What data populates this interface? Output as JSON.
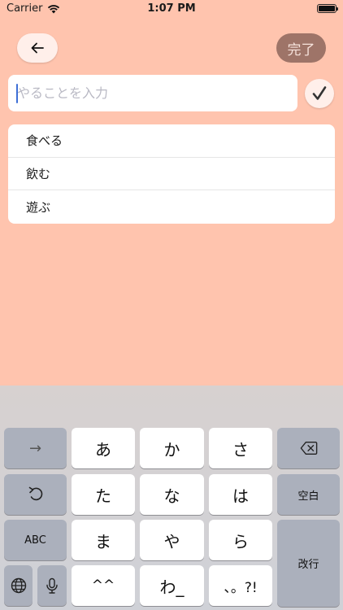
{
  "status_bar": {
    "carrier": "Carrier",
    "time": "1:07 PM"
  },
  "header": {
    "back_icon": "arrow-left-icon",
    "done_label": "完了"
  },
  "input": {
    "placeholder": "やることを入力",
    "value": "",
    "submit_icon": "checkmark-icon"
  },
  "suggestions": [
    "食べる",
    "飲む",
    "遊ぶ"
  ],
  "keyboard": {
    "row1": {
      "left": "→",
      "keys": [
        "あ",
        "か",
        "さ"
      ],
      "right_icon": "delete-backspace-icon"
    },
    "row2": {
      "left_icon": "undo-icon",
      "keys": [
        "た",
        "な",
        "は"
      ],
      "right": "空白"
    },
    "row3": {
      "left": "ABC",
      "keys": [
        "ま",
        "や",
        "ら"
      ],
      "right": "改行"
    },
    "row4": {
      "globe_icon": "globe-icon",
      "mic_icon": "microphone-icon",
      "keys": [
        "^^",
        "わ_",
        "、。?!"
      ]
    }
  },
  "colors": {
    "background": "#FFC4AE",
    "done_button": "#9E7468",
    "keyboard": "#D1D3D9"
  }
}
